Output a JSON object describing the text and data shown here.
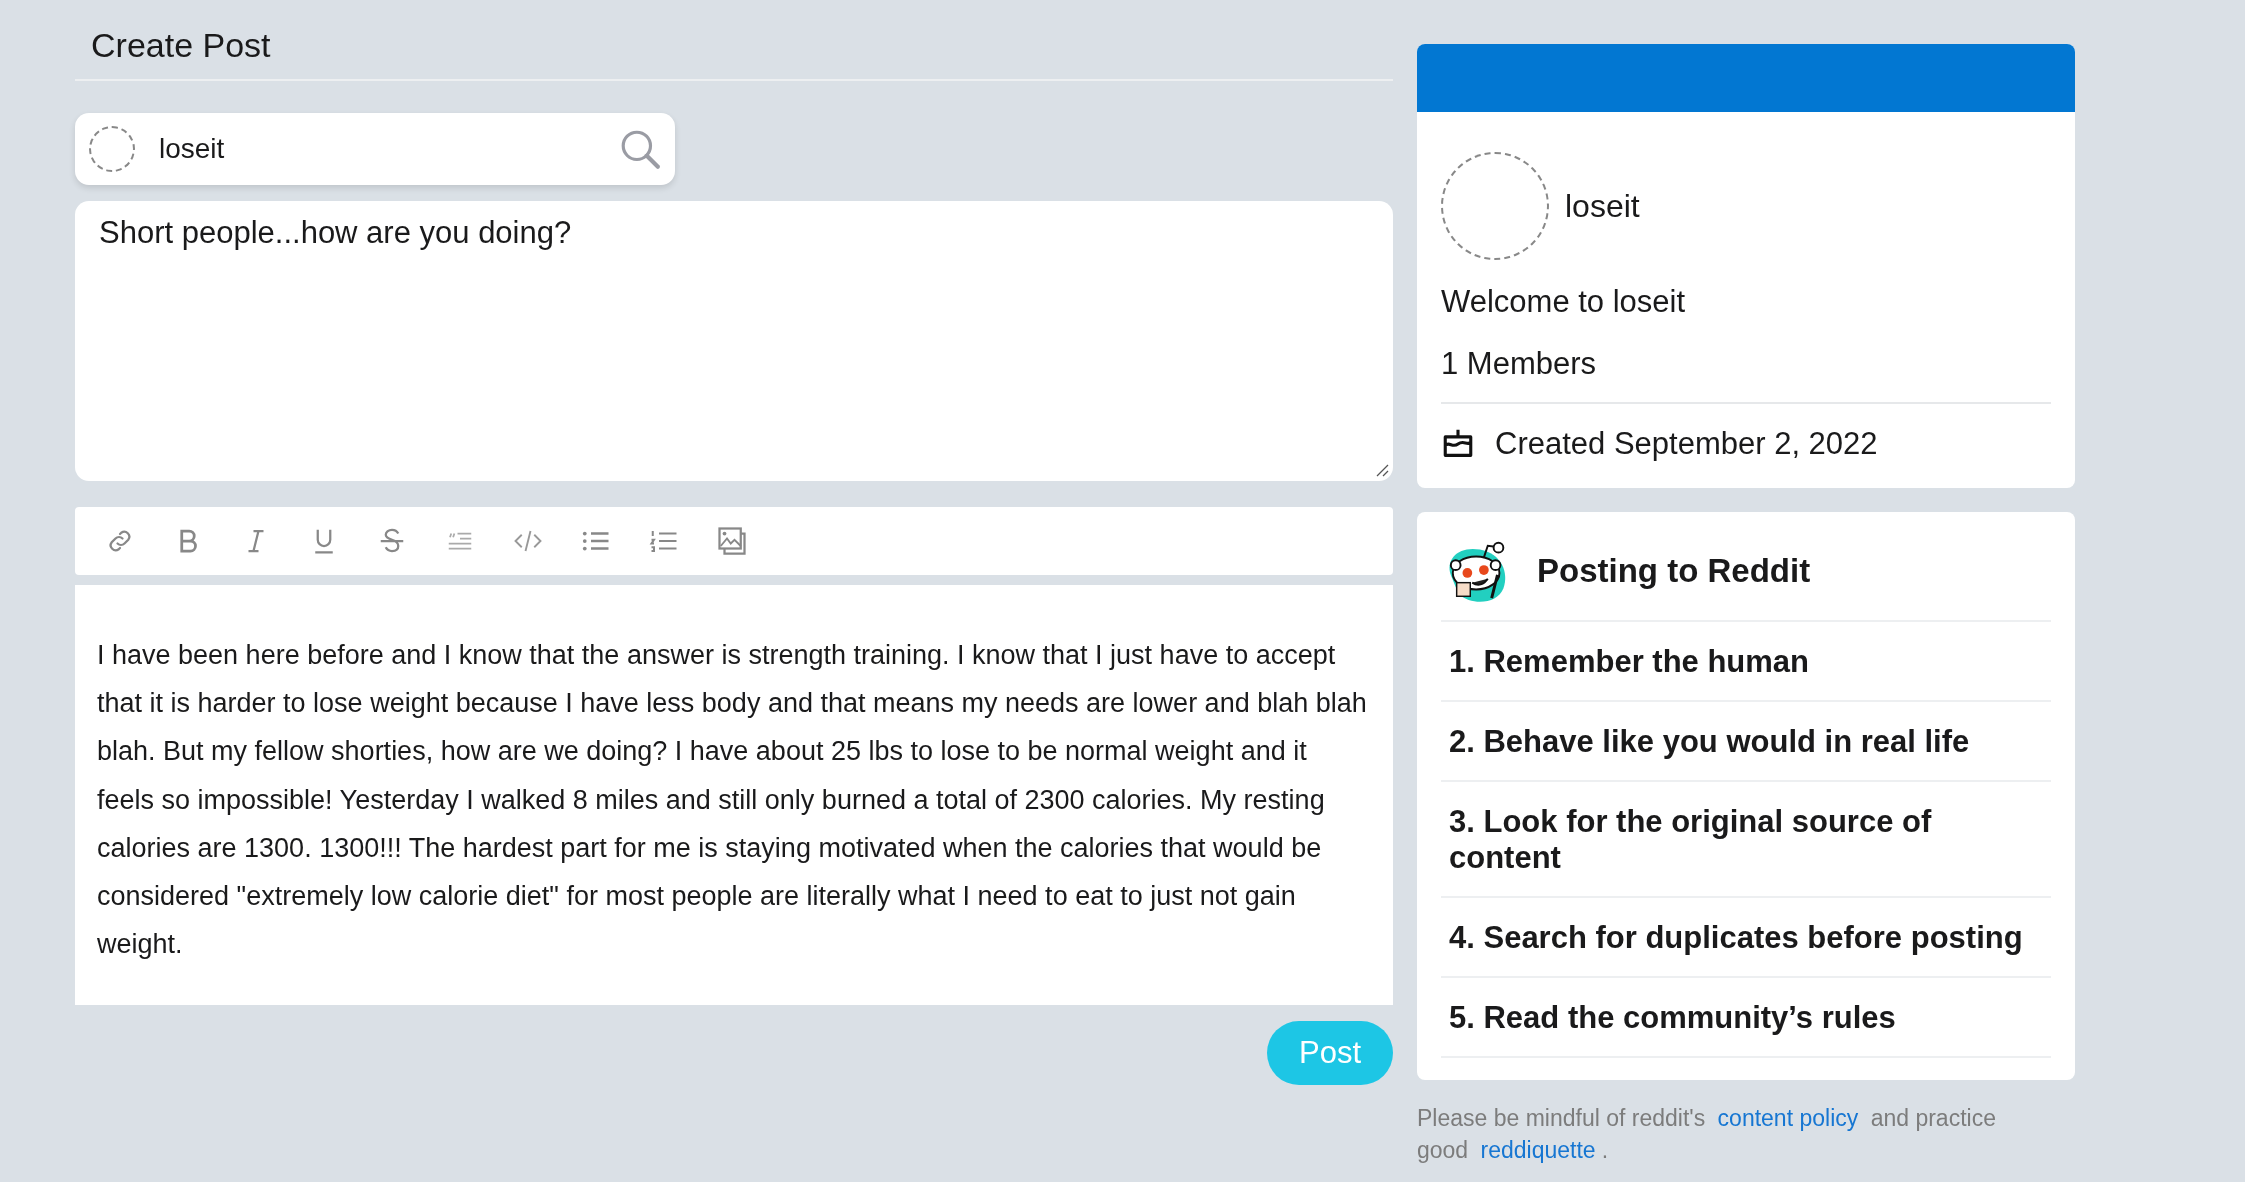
{
  "page_title": "Create Post",
  "community_picker": {
    "value": "loseit"
  },
  "post_title": {
    "value": "Short people...how are you doing?"
  },
  "post_body": {
    "value": "I have been here before and I know that the answer is strength training. I know that I just have to accept that it is harder to lose weight because I have less body and that means my needs are lower and blah blah blah. But my fellow shorties, how are we doing? I have about 25 lbs to lose to be normal weight and it feels so impossible! Yesterday I walked 8 miles and still only burned a total of 2300 calories. My resting calories are 1300. 1300!!! The hardest part for me is staying motivated when the calories that would be considered \"extremely low calorie diet\" for most people are literally what I need to eat to just not gain weight."
  },
  "post_button": "Post",
  "community_card": {
    "name": "loseit",
    "welcome": "Welcome to loseit",
    "members": "1 Members",
    "created": "Created September 2, 2022"
  },
  "rules_card": {
    "title": "Posting to Reddit",
    "rules": [
      "1. Remember the human",
      "2. Behave like you would in real life",
      "3. Look for the original source of content",
      "4. Search for duplicates before posting",
      "5. Read the community’s rules"
    ]
  },
  "footer": {
    "parts": [
      {
        "kind": "text",
        "text": "Please be mindful of reddit's "
      },
      {
        "kind": "link",
        "text": "content policy"
      },
      {
        "kind": "text",
        "text": " and practice good "
      },
      {
        "kind": "link",
        "text": "reddiquette"
      },
      {
        "kind": "text",
        "text": "."
      }
    ]
  }
}
